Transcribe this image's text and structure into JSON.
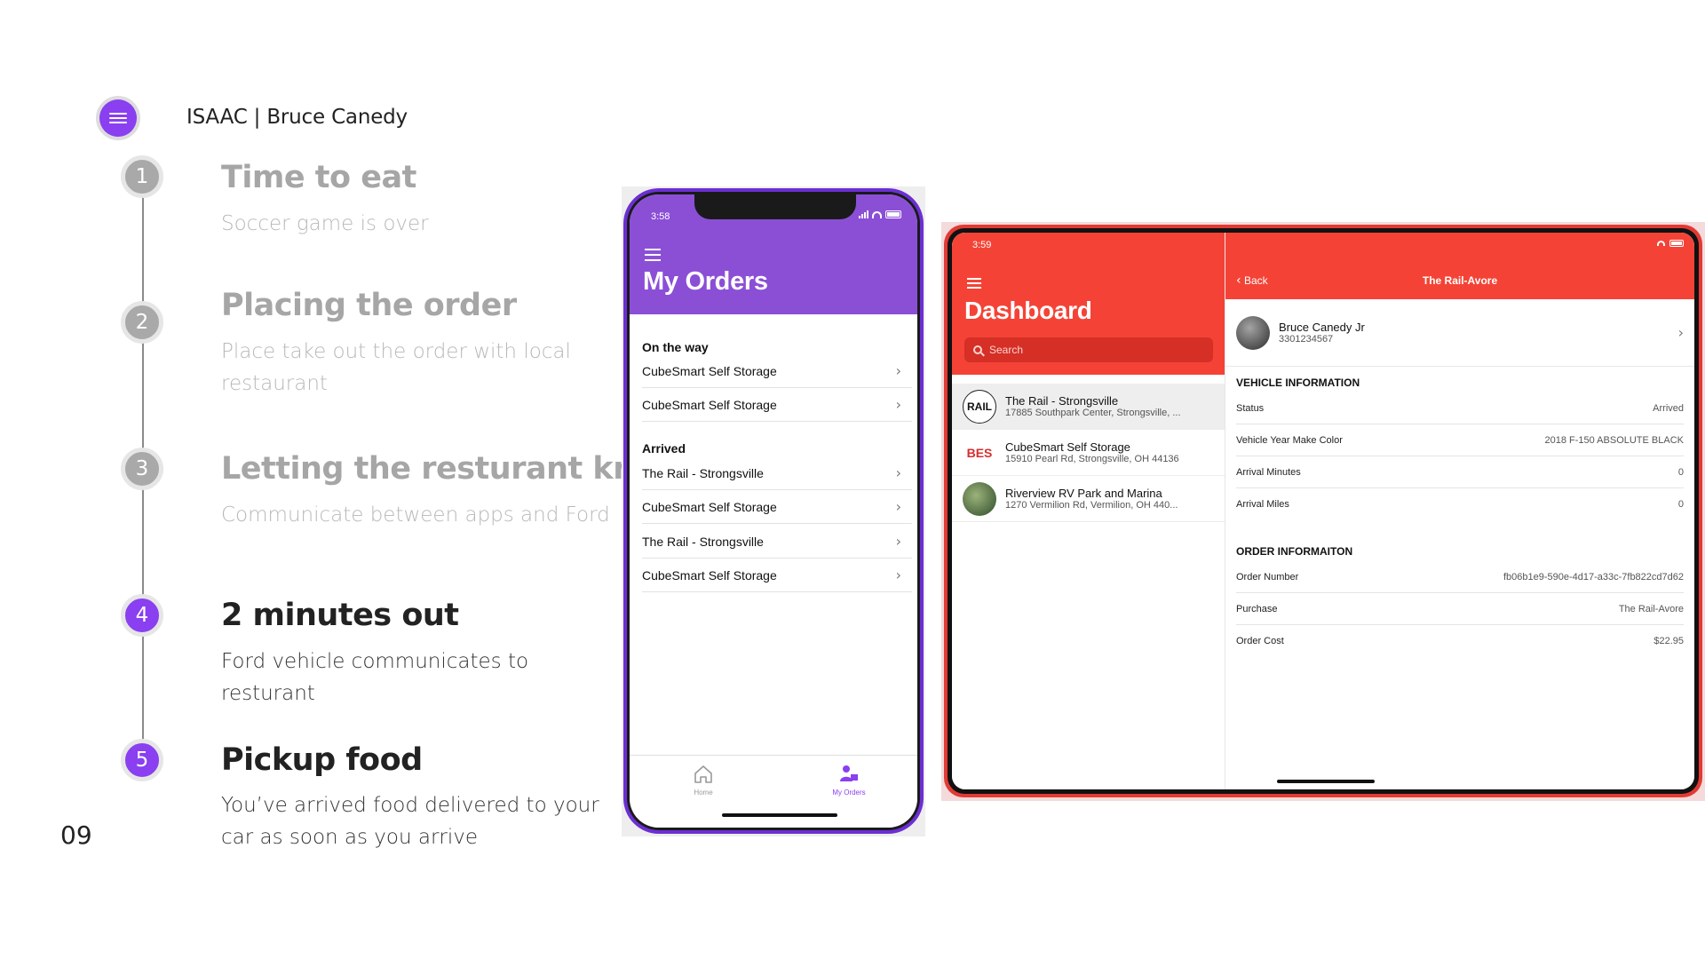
{
  "header": {
    "title": "ISAAC | Bruce Canedy"
  },
  "page_number": "09",
  "steps": [
    {
      "number": "1",
      "title": "Time to eat",
      "subtitle": "Soccer game is over"
    },
    {
      "number": "2",
      "title": "Placing the order",
      "subtitle": "Place take out the order with local restaurant"
    },
    {
      "number": "3",
      "title": "Letting the resturant know",
      "subtitle": "Communicate between apps and Ford"
    },
    {
      "number": "4",
      "title": "2 minutes out",
      "subtitle": "Ford vehicle communicates to resturant"
    },
    {
      "number": "5",
      "title": "Pickup food",
      "subtitle": "You’ve arrived food delivered to your car as soon as you arrive"
    }
  ],
  "phone": {
    "time": "3:58",
    "title": "My Orders",
    "sections": [
      {
        "label": "On the way",
        "items": [
          "CubeSmart Self Storage",
          "CubeSmart Self Storage"
        ]
      },
      {
        "label": "Arrived",
        "items": [
          "The Rail - Strongsville",
          "CubeSmart Self Storage",
          "The Rail - Strongsville",
          "CubeSmart Self Storage"
        ]
      }
    ],
    "tabs": [
      {
        "label": "Home",
        "icon": "home-icon"
      },
      {
        "label": "My Orders",
        "icon": "orders-icon"
      }
    ]
  },
  "tablet": {
    "time": "3:59",
    "dashboard_title": "Dashboard",
    "search_placeholder": "Search",
    "locations": [
      {
        "name": "The Rail - Strongsville",
        "address": "17885 Southpark Center, Strongsville, ...",
        "thumb": "RAIL"
      },
      {
        "name": "CubeSmart Self Storage",
        "address": "15910 Pearl Rd, Strongsville, OH 44136",
        "thumb": "BES"
      },
      {
        "name": "Riverview RV Park and Marina",
        "address": "1270 Vermilion Rd, Vermilion, OH 440...",
        "thumb": ""
      }
    ],
    "back_label": "Back",
    "detail_title": "The Rail-Avore",
    "user": {
      "name": "Bruce Canedy Jr",
      "phone": "3301234567"
    },
    "vehicle_heading": "VEHICLE INFORMATION",
    "vehicle": [
      {
        "key": "Status",
        "value": "Arrived"
      },
      {
        "key": "Vehicle Year Make Color",
        "value": "2018 F-150 ABSOLUTE BLACK"
      },
      {
        "key": "Arrival Minutes",
        "value": "0"
      },
      {
        "key": "Arrival Miles",
        "value": "0"
      }
    ],
    "order_heading": "ORDER INFORMAITON",
    "order": [
      {
        "key": "Order Number",
        "value": "fb06b1e9-590e-4d17-a33c-7fb822cd7d62"
      },
      {
        "key": "Purchase",
        "value": "The Rail-Avore"
      },
      {
        "key": "Order Cost",
        "value": "$22.95"
      }
    ]
  },
  "colors": {
    "accent_purple": "#8a3ff0",
    "phone_header": "#8b4fd6",
    "tablet_red": "#f44336",
    "muted_gray": "#a6a6a6"
  }
}
